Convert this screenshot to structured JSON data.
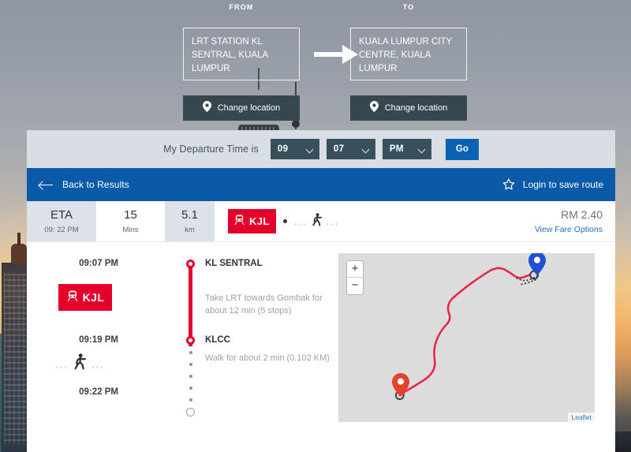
{
  "colors": {
    "brand_blue": "#0b5aa8",
    "button_blue": "#0b62b2",
    "rail_red": "#e4002b",
    "panel_gray": "#d9dee5",
    "dropdown_slate": "#37505c",
    "map_bg": "#dcdcdc",
    "pin_start": "#e8412b",
    "pin_end": "#2050d8"
  },
  "hero": {
    "from_label": "FROM",
    "to_label": "TO",
    "from_value": "LRT STATION KL SENTRAL, KUALA LUMPUR",
    "to_value": "KUALA LUMPUR CITY CENTRE, KUALA LUMPUR",
    "arrow_icon": "arrow-right-icon",
    "change_from_label": "Change location",
    "change_to_label": "Change location",
    "pin_icon": "map-pin-icon"
  },
  "time_bar": {
    "label": "My Departure Time is",
    "hour": "09",
    "minute": "07",
    "meridiem": "PM",
    "go_label": "Go",
    "chevron_icon": "chevron-down-icon"
  },
  "nav": {
    "back_label": "Back to Results",
    "back_icon": "arrow-left-icon",
    "save_label": "Login to save route",
    "star_icon": "star-outline-icon"
  },
  "summary": {
    "eta_label": "ETA",
    "eta_value": "09: 22 PM",
    "duration_value": "15",
    "duration_label": "Mins",
    "distance_value": "5.1",
    "distance_label": "km",
    "modes": {
      "rail_code": "KJL",
      "rail_icon": "train-icon",
      "separator": "•",
      "walk_icon": "walking-icon",
      "ellipsis_left": "...",
      "ellipsis_right": "..."
    },
    "fare_amount": "RM 2.40",
    "fare_link": "View Fare Options"
  },
  "itinerary": {
    "steps": [
      {
        "time": "09:07 PM",
        "stop": "KL SENTRAL",
        "mode_code": "KJL",
        "mode_icon": "train-icon",
        "desc": "Take LRT towards Gombak for about 12 min (5 stops)"
      },
      {
        "time": "09:19 PM",
        "stop": "KLCC",
        "mode_icon": "walking-icon",
        "ellipsis_left": "...",
        "ellipsis_right": "...",
        "desc": "Walk for about 2 min (0.102 KM)"
      },
      {
        "time": "09:22 PM",
        "stop": "",
        "desc": ""
      }
    ]
  },
  "map": {
    "zoom_in_label": "+",
    "zoom_out_label": "−",
    "attribution": "Leaflet",
    "start_pin_icon": "map-pin-start-icon",
    "end_pin_icon": "map-pin-end-icon",
    "route_icon": "route-line-icon"
  }
}
